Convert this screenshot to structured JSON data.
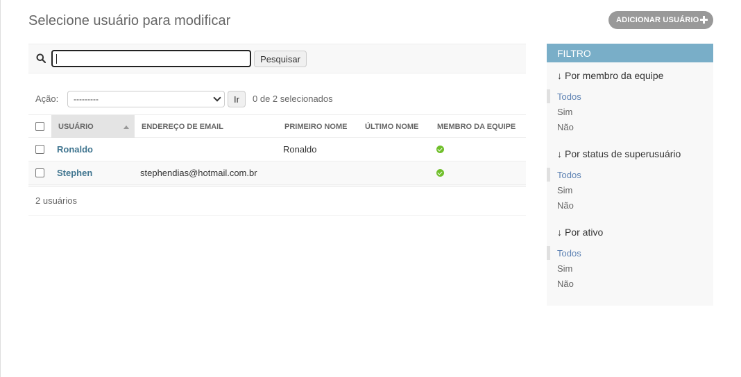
{
  "page": {
    "title": "Selecione usuário para modificar",
    "add_button_label": "ADICIONAR USUÁRIO"
  },
  "search": {
    "value": "",
    "button_label": "Pesquisar"
  },
  "actions": {
    "label": "Ação:",
    "selected_option": "---------",
    "go_label": "Ir",
    "selection_count": "0 de 2 selecionados"
  },
  "table": {
    "columns": [
      "USUÁRIO",
      "ENDEREÇO DE EMAIL",
      "PRIMEIRO NOME",
      "ÚLTIMO NOME",
      "MEMBRO DA EQUIPE"
    ],
    "rows": [
      {
        "username": "Ronaldo",
        "email": "",
        "first_name": "Ronaldo",
        "last_name": "",
        "staff": true
      },
      {
        "username": "Stephen",
        "email": "stephendias@hotmail.com.br",
        "first_name": "",
        "last_name": "",
        "staff": true
      }
    ],
    "count_text": "2 usuários"
  },
  "filter": {
    "title": "FILTRO",
    "groups": [
      {
        "title": "Por membro da equipe",
        "options": [
          "Todos",
          "Sim",
          "Não"
        ],
        "selected": "Todos"
      },
      {
        "title": "Por status de superusuário",
        "options": [
          "Todos",
          "Sim",
          "Não"
        ],
        "selected": "Todos"
      },
      {
        "title": "Por ativo",
        "options": [
          "Todos",
          "Sim",
          "Não"
        ],
        "selected": "Todos"
      }
    ]
  },
  "colors": {
    "filter_header": "#79aec8",
    "link": "#417690",
    "selected_filter": "#5b80b2",
    "yes_icon": "#70bf2b",
    "add_button": "#999999"
  },
  "icons": {
    "search": "search-icon",
    "add": "plus-icon",
    "sort": "sort-asc-icon",
    "yes": "check-circle-icon",
    "filter_arrow": "arrow-down-icon"
  }
}
